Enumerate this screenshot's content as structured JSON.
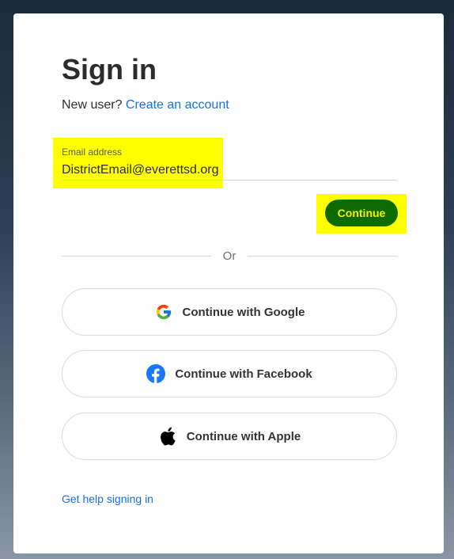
{
  "title": "Sign in",
  "new_user": {
    "prefix": "New user? ",
    "link": "Create an account"
  },
  "email": {
    "label": "Email address",
    "value": "DistrictEmail@everettsd.org"
  },
  "continue_label": "Continue",
  "divider_text": "Or",
  "social": {
    "google": "Continue with Google",
    "facebook": "Continue with Facebook",
    "apple": "Continue with Apple"
  },
  "help_link": "Get help signing in",
  "colors": {
    "highlight": "#ffff00",
    "continue_bg": "#0d6b00",
    "link": "#1473e6"
  }
}
